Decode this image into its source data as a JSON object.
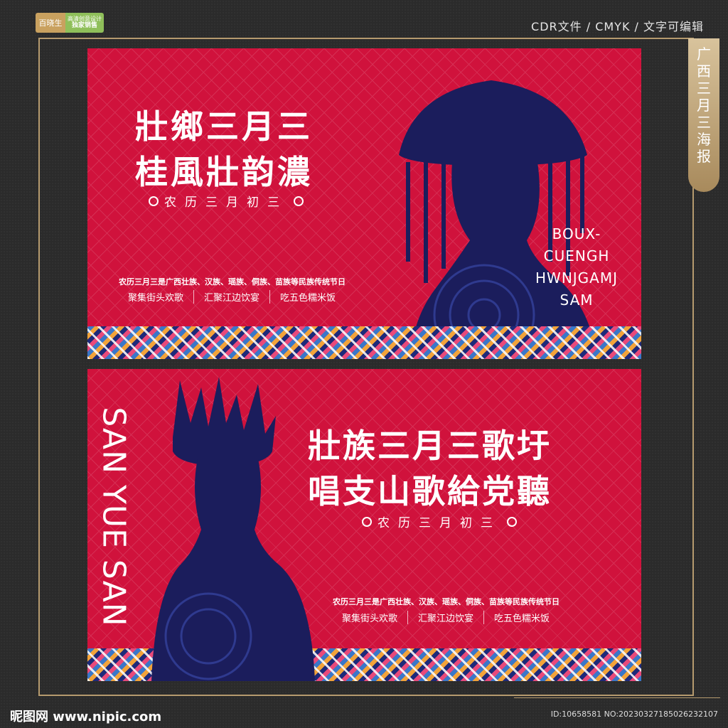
{
  "badge": {
    "brand": "百晓生",
    "line1": "高清创意设计",
    "line2": "独家销售"
  },
  "topinfo": "CDR文件 / CMYK / 文字可编辑",
  "ribbon": [
    "广",
    "西",
    "三",
    "月",
    "三",
    "海",
    "报"
  ],
  "panel1": {
    "title_line1": "壯鄉三月三",
    "title_line2": "桂風壯韵濃",
    "lunar": "农历三月初三",
    "desc": "农历三月三是广西壮族、汉族、瑶族、侗族、苗族等民族传统节日",
    "activities": [
      "聚集街头欢歌",
      "汇聚江边饮宴",
      "吃五色糯米饭"
    ],
    "zhuang_lines": [
      "BOUX-",
      "CUENGH",
      "HWNJGAMJ",
      "SAM"
    ]
  },
  "panel2": {
    "title_line1": "壯族三月三歌圩",
    "title_line2": "唱支山歌給党聽",
    "lunar": "农历三月初三",
    "desc": "农历三月三是广西壮族、汉族、瑶族、侗族、苗族等民族传统节日",
    "activities": [
      "聚集街头欢歌",
      "汇聚江边饮宴",
      "吃五色糯米饭"
    ],
    "vertical_text": "SAN YUE SAN"
  },
  "footer": {
    "logo": "昵图网 www.nipic.com",
    "id": "ID:10658581 NO:20230327185026232107"
  },
  "colors": {
    "panel_red": "#d0123c",
    "silhouette_navy": "#1b1d5c",
    "frame_gold": "#b59a6e",
    "background": "#2b2b2b"
  }
}
